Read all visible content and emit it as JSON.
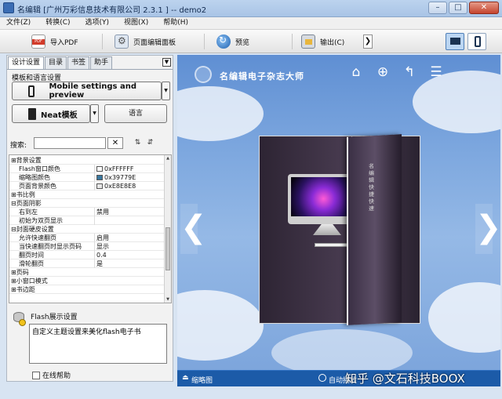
{
  "window": {
    "title": "名编辑 [广州万彩信息技术有限公司 2.3.1 ] -- demo2",
    "buttons": [
      "–",
      "□",
      "✕"
    ]
  },
  "menu": [
    "文件(Z)",
    "转换(C)",
    "选项(Y)",
    "视图(X)",
    "帮助(H)"
  ],
  "toolbar": {
    "import_pdf": "导入PDF",
    "page_editor": "页面编辑面板",
    "preview": "预览",
    "export": "输出(C)",
    "more": "❯",
    "view_modes": [
      "desktop-icon",
      "mobile-icon"
    ],
    "active_view": "desktop"
  },
  "left_panel": {
    "tabs": [
      "设计设置",
      "目录",
      "书签",
      "助手"
    ],
    "active_tab": "设计设置",
    "tab_menu": "▼",
    "template_section_label": "模板和语言设置",
    "mobile_button": "Mobile settings and preview",
    "neat_template_button": "Neat模板",
    "dropdown": "▼",
    "language_button": "语言",
    "search": {
      "label": "搜索:",
      "value": "",
      "clear": "✕",
      "sort_icons": [
        "⇅",
        "⇵"
      ]
    },
    "properties": [
      {
        "name": "⊞背景设置",
        "value": "",
        "group": true
      },
      {
        "name": "Flash窗口颜色",
        "value": "0xFFFFFF",
        "swatch": "#FFFFFF"
      },
      {
        "name": "缩略图颜色",
        "value": "0x39779E",
        "swatch": "#39779E"
      },
      {
        "name": "页面背景颜色",
        "value": "0xE8E8E8",
        "swatch": "#E8E8E8"
      },
      {
        "name": "⊞书比例",
        "value": "",
        "group": true
      },
      {
        "name": "⊟页面阴影",
        "value": "",
        "group": true
      },
      {
        "name": "右到左",
        "value": "禁用"
      },
      {
        "name": "初始为双页显示",
        "value": ""
      },
      {
        "name": "⊟封面硬皮设置",
        "value": "",
        "group": true
      },
      {
        "name": "允许快速翻页",
        "value": "启用"
      },
      {
        "name": "当快速翻页时显示页码",
        "value": "显示"
      },
      {
        "name": "翻页时间",
        "value": "0.4"
      },
      {
        "name": "滑轮翻页",
        "value": "是"
      },
      {
        "name": "⊞页码",
        "value": "",
        "group": true
      },
      {
        "name": "⊞小窗口模式",
        "value": "",
        "group": true
      },
      {
        "name": "⊞书边距",
        "value": "",
        "group": true
      }
    ],
    "description": {
      "title": "Flash展示设置",
      "text": "自定义主题设置来美化flash电子书"
    },
    "online_help": "在线帮助"
  },
  "preview": {
    "title": "名编辑电子杂志大师",
    "header_icons": [
      "home-icon",
      "zoom-in-icon",
      "back-icon",
      "menu-icon"
    ],
    "header_glyphs": [
      "⌂",
      "⊕",
      "↰",
      "☰"
    ],
    "book_side_text": "名编辑 快捷 快速",
    "prev_arrow": "❮",
    "next_arrow": "❯",
    "thumbnails_label": "缩略图",
    "autoplay_label": "自动播放",
    "watermark": "知乎 @文石科技BOOX",
    "colors": {
      "bottom_bar": "#1c5ba8",
      "sky": "#7ea8df"
    }
  }
}
